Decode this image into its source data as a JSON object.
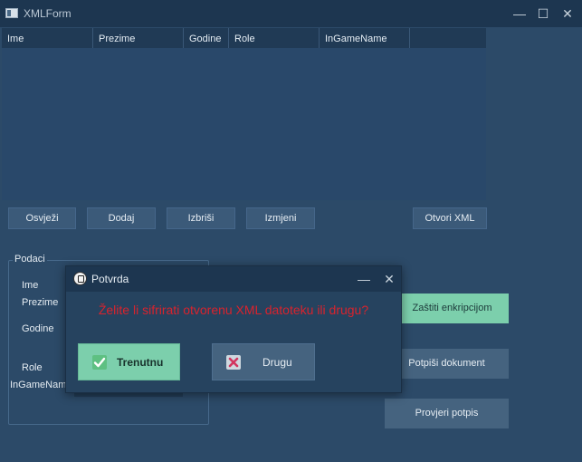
{
  "window": {
    "title": "XMLForm",
    "minimize": "—",
    "maximize": "☐",
    "close": "✕"
  },
  "table": {
    "columns": [
      "Ime",
      "Prezime",
      "Godine",
      "Role",
      "InGameName"
    ],
    "rows": []
  },
  "toolbar": {
    "refresh": "Osvježi",
    "add": "Dodaj",
    "delete": "Izbriši",
    "edit": "Izmjeni",
    "open_xml": "Otvori XML"
  },
  "group": {
    "title": "Podaci",
    "labels": [
      "Ime",
      "Prezime",
      "Godine",
      "Role",
      "InGameName"
    ]
  },
  "actions": {
    "encrypt": "Zaštiti enkripcijom",
    "sign": "Potpiši dokument",
    "verify": "Provjeri potpis"
  },
  "dialog": {
    "title": "Potvrda",
    "minimize": "—",
    "close": "✕",
    "message": "Želite li sifrirati otvorenu XML datoteku ili drugu?",
    "current_label": "Trenutnu",
    "other_label": "Drugu"
  },
  "colors": {
    "accent_green": "#7ccfac",
    "message_red": "#d9232d",
    "background": "#2c4a68"
  }
}
